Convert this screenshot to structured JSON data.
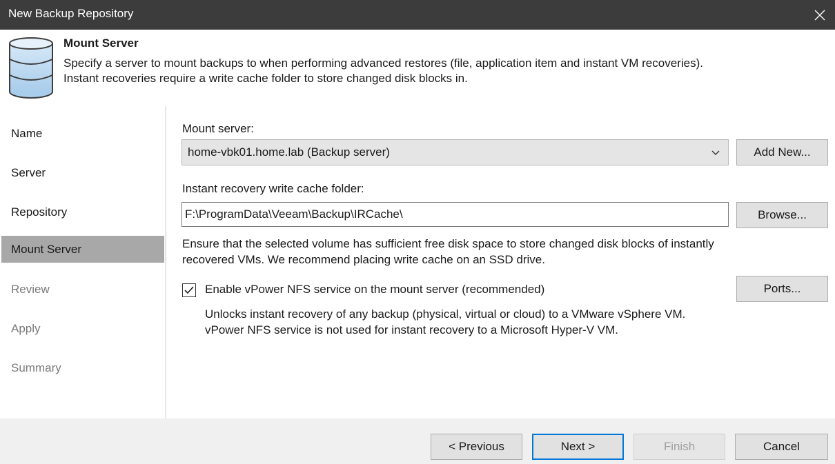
{
  "window": {
    "title": "New Backup Repository",
    "close_icon": "close-icon"
  },
  "header": {
    "icon": "database-icon",
    "title": "Mount Server",
    "description_line1": "Specify a server to mount backups to when performing advanced restores (file, application item and instant VM recoveries).",
    "description_line2": "Instant recoveries require a write cache folder to store changed disk blocks in."
  },
  "steps": [
    {
      "label": "Name",
      "state": "done"
    },
    {
      "label": "Server",
      "state": "done"
    },
    {
      "label": "Repository",
      "state": "done"
    },
    {
      "label": "Mount Server",
      "state": "active"
    },
    {
      "label": "Review",
      "state": "pending"
    },
    {
      "label": "Apply",
      "state": "pending"
    },
    {
      "label": "Summary",
      "state": "pending"
    }
  ],
  "main": {
    "mount_server_label": "Mount server:",
    "mount_server_value": "home-vbk01.home.lab (Backup server)",
    "add_new_label": "Add New...",
    "cache_label": "Instant recovery write cache folder:",
    "cache_value": "F:\\ProgramData\\Veeam\\Backup\\IRCache\\",
    "browse_label": "Browse...",
    "note_line1": "Ensure that the selected volume has sufficient free disk space to store changed disk blocks of instantly",
    "note_line2": "recovered VMs. We recommend placing write cache on an SSD drive.",
    "nfs_checkbox_label": "Enable vPower NFS service on the mount server (recommended)",
    "nfs_checked": true,
    "ports_label": "Ports...",
    "nfs_note_line1": "Unlocks instant recovery of any backup (physical, virtual or cloud) to a VMware vSphere VM.",
    "nfs_note_line2": "vPower NFS service is not used for instant recovery to a Microsoft Hyper-V VM."
  },
  "footer": {
    "previous_label": "< Previous",
    "next_label": "Next >",
    "finish_label": "Finish",
    "cancel_label": "Cancel"
  },
  "colors": {
    "titlebar_bg": "#3c3c3c",
    "active_step_bg": "#a8a8a8",
    "default_button_border": "#0078d7",
    "footer_bg": "#f0f0f0"
  }
}
